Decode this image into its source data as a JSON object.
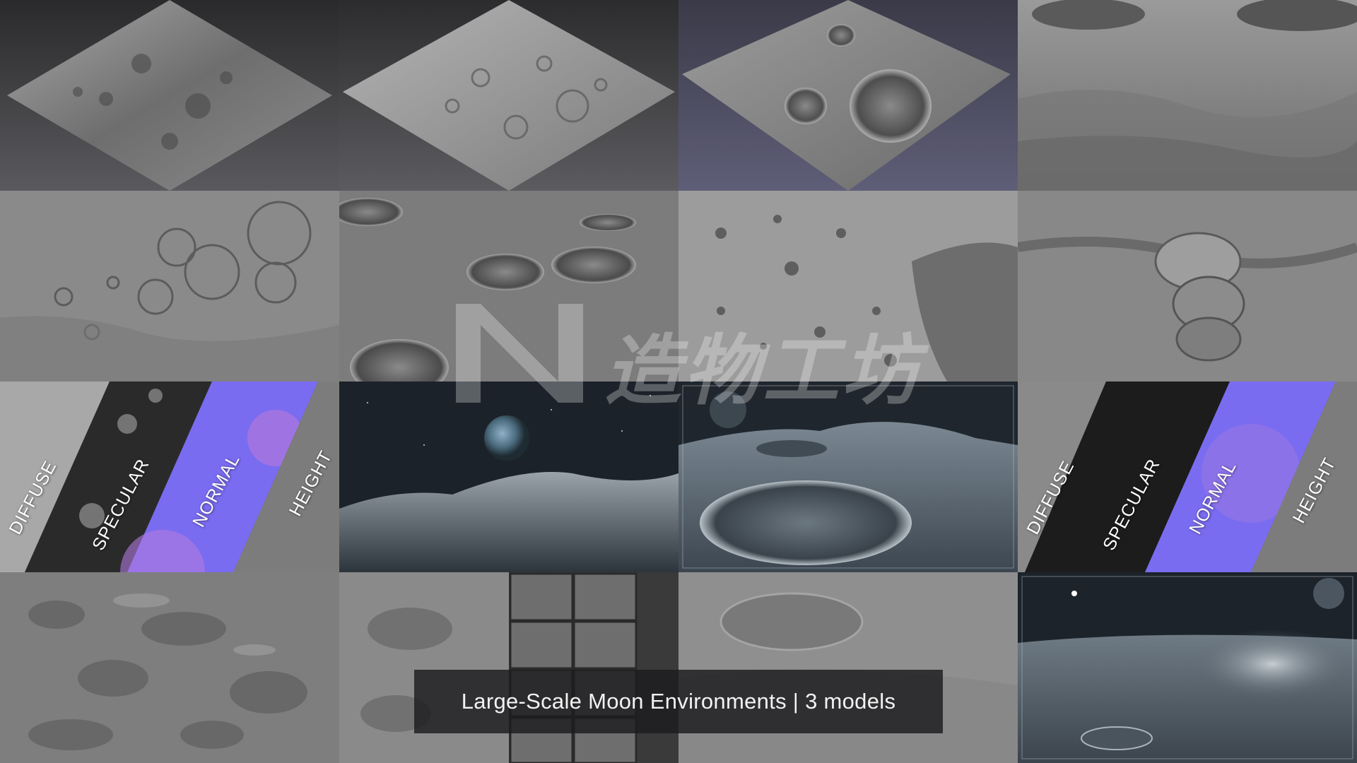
{
  "tiles": [
    {
      "id": "r1c1",
      "kind": "diamond-terrain"
    },
    {
      "id": "r1c2",
      "kind": "diamond-terrain"
    },
    {
      "id": "r1c3",
      "kind": "diamond-crater"
    },
    {
      "id": "r1c4",
      "kind": "terrain-perspective"
    },
    {
      "id": "r2c1",
      "kind": "crater-closeup"
    },
    {
      "id": "r2c2",
      "kind": "crater-closeup"
    },
    {
      "id": "r2c3",
      "kind": "rocky-surface"
    },
    {
      "id": "r2c4",
      "kind": "rock-formation"
    },
    {
      "id": "r3c1",
      "kind": "texture-maps"
    },
    {
      "id": "r3c2",
      "kind": "earthrise"
    },
    {
      "id": "r3c3",
      "kind": "crater-render"
    },
    {
      "id": "r3c4",
      "kind": "texture-maps"
    },
    {
      "id": "r4c1",
      "kind": "rough-terrain"
    },
    {
      "id": "r4c2",
      "kind": "terrain-with-thumbnails"
    },
    {
      "id": "r4c3",
      "kind": "smooth-terrain"
    },
    {
      "id": "r4c4",
      "kind": "night-surface"
    }
  ],
  "texture_maps_left": {
    "diffuse": "DIFFUSE",
    "specular": "SPECULAR",
    "normal": "NORMAL",
    "height": "HEIGHT"
  },
  "texture_maps_right": {
    "diffuse": "DIFFUSE",
    "specular": "SPECULAR",
    "normal": "NORMAL",
    "height": "HEIGHT"
  },
  "watermark": {
    "text": "造物工坊",
    "logo_icon": "nv-logo-icon"
  },
  "caption": {
    "text": "Large-Scale Moon Environments | 3 models"
  },
  "colors": {
    "moon_gray": "#8e8e8e",
    "normal_map": "#7a6cf0",
    "space": "#1c2229",
    "caption_bg": "#1c1c1e"
  }
}
